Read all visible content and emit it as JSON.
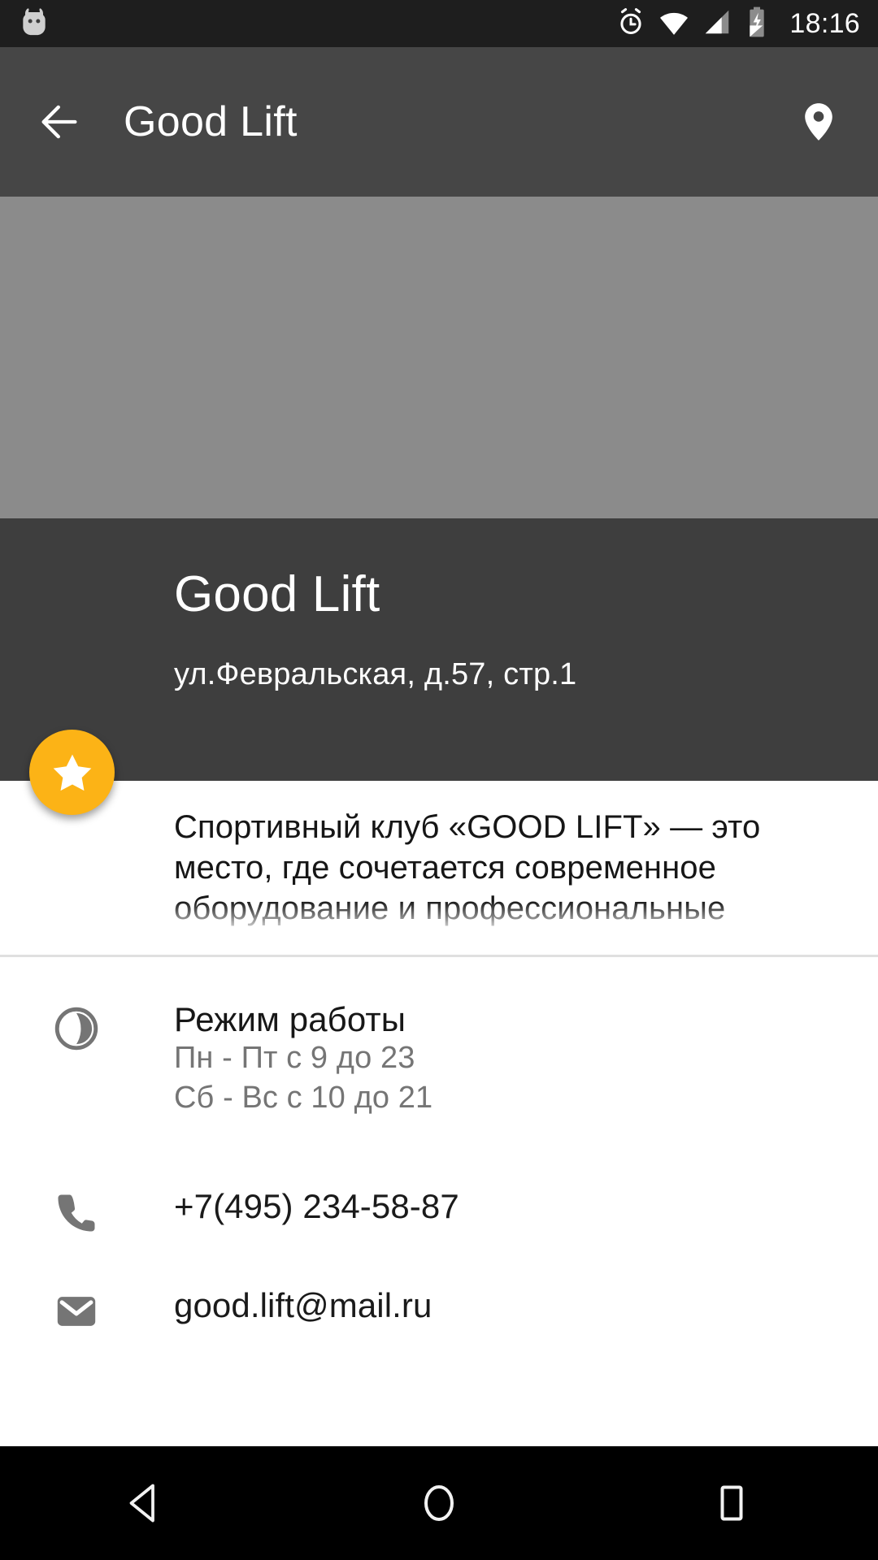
{
  "statusbar": {
    "os_logo_icon": "cyanogenmod-logo-icon",
    "alarm_icon": "alarm-clock-icon",
    "wifi_icon": "wifi-full-icon",
    "signal_icon": "cellular-signal-icon",
    "battery_icon": "battery-charging-icon",
    "time": "18:16"
  },
  "toolbar": {
    "back_icon": "arrow-back-icon",
    "title": "Good Lift",
    "map_icon": "map-pin-icon"
  },
  "hero": {
    "placeholder_color": "#8b8b8b"
  },
  "info_panel": {
    "name": "Good Lift",
    "address": "ул.Февральская, д.57, стр.1",
    "background_color": "#3e3e3e"
  },
  "favorite_fab": {
    "icon": "star-icon",
    "color": "#fcb316"
  },
  "description": {
    "text": "Спортивный клуб «GOOD LIFT» — это место, где сочетается современное оборудование и профессиональные"
  },
  "details": {
    "hours": {
      "icon": "clock-half-icon",
      "title": "Режим работы",
      "line1": "Пн - Пт  с 9 до 23",
      "line2": "Сб - Вс  с 10 до 21"
    },
    "phone": {
      "icon": "phone-icon",
      "value": "+7(495) 234-58-87"
    },
    "email": {
      "icon": "envelope-icon",
      "value": "good.lift@mail.ru"
    }
  },
  "navbar": {
    "back_icon": "nav-back-triangle-icon",
    "home_icon": "nav-home-circle-icon",
    "recents_icon": "nav-recents-square-icon"
  }
}
